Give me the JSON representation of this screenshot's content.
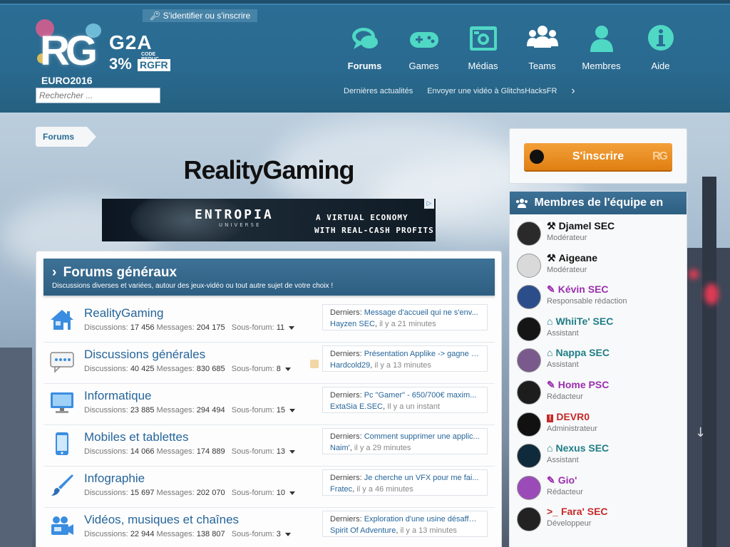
{
  "header": {
    "login_label": "S'identifier ou s'inscrire",
    "logo_text": "RG",
    "logo_subtitle": "EURO2016",
    "g2a": {
      "brand": "G2A",
      "percent": "3%",
      "code_label": "CODE REDUC.",
      "code": "RGFR"
    },
    "search_placeholder": "Rechercher ...",
    "nav": [
      {
        "label": "Forums",
        "icon": "chat-icon",
        "active": true
      },
      {
        "label": "Games",
        "icon": "gamepad-icon"
      },
      {
        "label": "Médias",
        "icon": "camera-icon"
      },
      {
        "label": "Teams",
        "icon": "group-icon"
      },
      {
        "label": "Membres",
        "icon": "user-icon"
      },
      {
        "label": "Aide",
        "icon": "info-icon"
      }
    ],
    "subnav": [
      "Dernières actualités",
      "Envoyer une vidéo à GlitchsHacksFR"
    ]
  },
  "breadcrumb": "Forums",
  "page_title": "RealityGaming",
  "banner": {
    "title": "ENTROPIA",
    "subtitle": "UNIVERSE",
    "tag1": "A VIRTUAL ECONOMY",
    "tag2": "WITH REAL-CASH PROFITS"
  },
  "category": {
    "title": "Forums généraux",
    "description": "Discussions diverses et variées, autour des jeux-vidéo ou tout autre sujet de votre choix !"
  },
  "labels": {
    "discussions": "Discussions:",
    "messages": "Messages:",
    "subforum": "Sous-forum:",
    "last": "Derniers:"
  },
  "forums": [
    {
      "name": "RealityGaming",
      "icon": "house-icon",
      "discussions": "17 456",
      "messages": "204 175",
      "subforums": "11",
      "last_title": "Message d'accueil qui ne s'env...",
      "last_user": "Hayzen SEC",
      "last_time": "il y a 21 minutes"
    },
    {
      "name": "Discussions générales",
      "icon": "speech-bubble-icon",
      "discussions": "40 425",
      "messages": "830 685",
      "subforums": "8",
      "last_title": "Présentation Applike -> gagne f...",
      "last_user": "Hardcold29",
      "last_time": "il y a 13 minutes",
      "rss": true
    },
    {
      "name": "Informatique",
      "icon": "monitor-icon",
      "discussions": "23 885",
      "messages": "294 494",
      "subforums": "15",
      "last_title": "Pc \"Gamer\" - 650/700€ maxim...",
      "last_user": "ExtaSia E.SEC",
      "last_time": "Il y a un instant"
    },
    {
      "name": "Mobiles et tablettes",
      "icon": "mobile-icon",
      "discussions": "14 066",
      "messages": "174 889",
      "subforums": "13",
      "last_title": "Comment supprimer une applic...",
      "last_user": "Naim'",
      "last_time": "il y a 29 minutes"
    },
    {
      "name": "Infographie",
      "icon": "brush-icon",
      "discussions": "15 697",
      "messages": "202 070",
      "subforums": "10",
      "last_title": "Je cherche un VFX pour me fai...",
      "last_user": "Fratec",
      "last_time": "il y a 46 minutes"
    },
    {
      "name": "Vidéos, musiques et chaînes",
      "icon": "video-camera-icon",
      "discussions": "22 944",
      "messages": "138 807",
      "subforums": "3",
      "last_title": "Exploration d'une usine désaffe...",
      "last_user": "Spirit Of Adventure",
      "last_time": "il y a 13 minutes"
    }
  ],
  "sidebar": {
    "signup_label": "S'inscrire",
    "signup_logo": "RG",
    "team_title": "Membres de l'équipe en ligne",
    "members": [
      {
        "name": "Djamel SEC",
        "role": "Modérateur",
        "color": "#111111",
        "icon": "gavel-icon"
      },
      {
        "name": "Aigeane",
        "role": "Modérateur",
        "color": "#111111",
        "icon": "gavel-icon"
      },
      {
        "name": "Kévin SEC",
        "role": "Responsable rédaction",
        "color": "#9b2fae",
        "icon": "pencil-icon"
      },
      {
        "name": "WhiiTe' SEC",
        "role": "Assistant",
        "color": "#1f7d86",
        "icon": "graduation-cap-icon"
      },
      {
        "name": "Nappa SEC",
        "role": "Assistant",
        "color": "#1f7d86",
        "icon": "graduation-cap-icon"
      },
      {
        "name": "Home PSC",
        "role": "Rédacteur",
        "color": "#9b2fae",
        "icon": "pencil-icon"
      },
      {
        "name": "DEVR0",
        "role": "Administrateur",
        "color": "#c62828",
        "icon": "alert-icon"
      },
      {
        "name": "Nexus SEC",
        "role": "Assistant",
        "color": "#1f7d86",
        "icon": "graduation-cap-icon"
      },
      {
        "name": "Gio'",
        "role": "Rédacteur",
        "color": "#9b2fae",
        "icon": "pencil-icon"
      },
      {
        "name": "Fara' SEC",
        "role": "Développeur",
        "color": "#c62828",
        "icon": "terminal-icon"
      }
    ]
  },
  "colors": {
    "header_bg": "#2b6d94",
    "link": "#26659a",
    "signup": "#e8891f"
  }
}
